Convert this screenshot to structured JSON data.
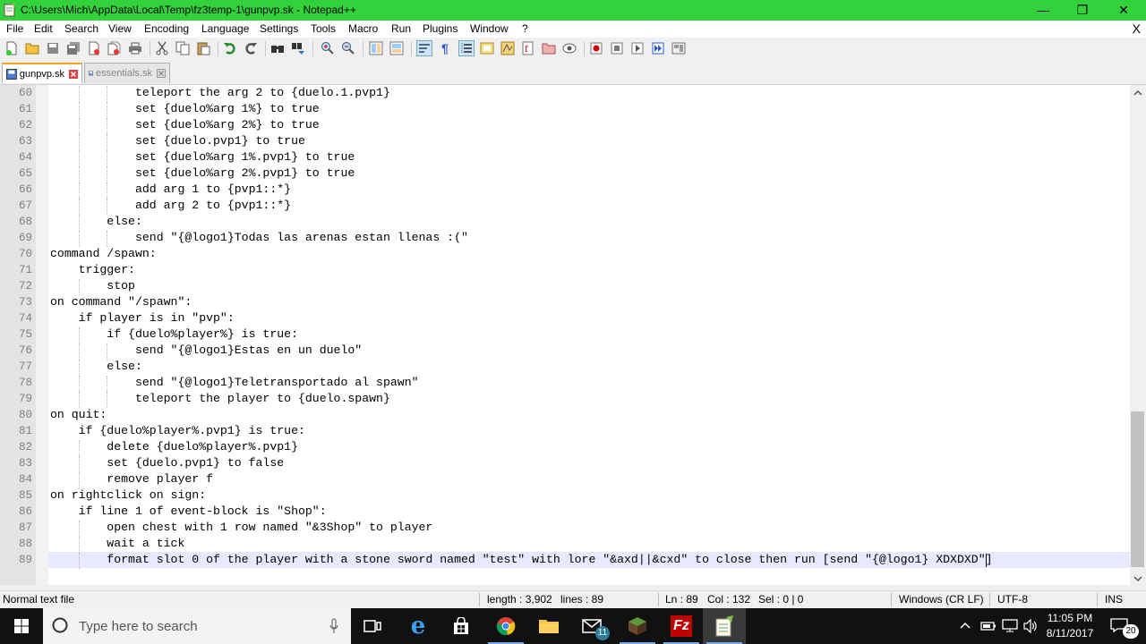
{
  "window": {
    "title": "C:\\Users\\Mich\\AppData\\Local\\Temp\\fz3temp-1\\gunpvp.sk - Notepad++",
    "app_icon": "notepad-plus-plus-icon",
    "minimize_glyph": "—",
    "maximize_glyph": "❐",
    "close_glyph": "✕"
  },
  "menu": {
    "items": [
      "File",
      "Edit",
      "Search",
      "View",
      "Encoding",
      "Language",
      "Settings",
      "Tools",
      "Macro",
      "Run",
      "Plugins",
      "Window",
      "?"
    ],
    "close_doc_glyph": "X"
  },
  "toolbar": {
    "icons": [
      "new-file-icon",
      "open-file-icon",
      "save-icon",
      "save-all-icon",
      "close-icon",
      "close-all-icon",
      "print-icon",
      "cut-icon",
      "copy-icon",
      "paste-icon",
      "undo-icon",
      "redo-icon",
      "find-icon",
      "replace-icon",
      "zoom-in-icon",
      "zoom-out-icon",
      "sync-vertical-icon",
      "sync-horizontal-icon",
      "word-wrap-icon",
      "show-all-chars-icon",
      "indent-guide-icon",
      "user-define-lang-icon",
      "doc-map-icon",
      "function-list-icon",
      "folder-workspace-icon",
      "monitoring-icon",
      "record-macro-icon",
      "stop-record-icon",
      "play-macro-icon",
      "run-macro-multiple-icon",
      "save-macro-icon"
    ]
  },
  "tabs": [
    {
      "label": "gunpvp.sk",
      "active": true
    },
    {
      "label": "essentials.sk",
      "active": false
    }
  ],
  "editor": {
    "lines": [
      {
        "n": "60",
        "text": "            teleport the arg 2 to {duelo.1.pvp1}"
      },
      {
        "n": "61",
        "text": "            set {duelo%arg 1%} to true"
      },
      {
        "n": "62",
        "text": "            set {duelo%arg 2%} to true"
      },
      {
        "n": "63",
        "text": "            set {duelo.pvp1} to true"
      },
      {
        "n": "64",
        "text": "            set {duelo%arg 1%.pvp1} to true"
      },
      {
        "n": "65",
        "text": "            set {duelo%arg 2%.pvp1} to true"
      },
      {
        "n": "66",
        "text": "            add arg 1 to {pvp1::*}"
      },
      {
        "n": "67",
        "text": "            add arg 2 to {pvp1::*}"
      },
      {
        "n": "68",
        "text": "        else:"
      },
      {
        "n": "69",
        "text": "            send \"{@logo1}Todas las arenas estan llenas :(\""
      },
      {
        "n": "70",
        "text": "command /spawn:"
      },
      {
        "n": "71",
        "text": "    trigger:"
      },
      {
        "n": "72",
        "text": "        stop"
      },
      {
        "n": "73",
        "text": "on command \"/spawn\":"
      },
      {
        "n": "74",
        "text": "    if player is in \"pvp\":"
      },
      {
        "n": "75",
        "text": "        if {duelo%player%} is true:"
      },
      {
        "n": "76",
        "text": "            send \"{@logo1}Estas en un duelo\""
      },
      {
        "n": "77",
        "text": "        else:"
      },
      {
        "n": "78",
        "text": "            send \"{@logo1}Teletransportado al spawn\""
      },
      {
        "n": "79",
        "text": "            teleport the player to {duelo.spawn}"
      },
      {
        "n": "80",
        "text": "on quit:"
      },
      {
        "n": "81",
        "text": "    if {duelo%player%.pvp1} is true:"
      },
      {
        "n": "82",
        "text": "        delete {duelo%player%.pvp1}"
      },
      {
        "n": "83",
        "text": "        set {duelo.pvp1} to false"
      },
      {
        "n": "84",
        "text": "        remove player f"
      },
      {
        "n": "85",
        "text": "on rightclick on sign:"
      },
      {
        "n": "86",
        "text": "    if line 1 of event-block is \"Shop\":"
      },
      {
        "n": "87",
        "text": "        open chest with 1 row named \"&3Shop\" to player"
      },
      {
        "n": "88",
        "text": "        wait a tick"
      },
      {
        "n": "89",
        "text": "        format slot 0 of the player with a stone sword named \"test\" with lore \"&axd||&cxd\" to close then run [send \"{@logo1} XDXDXD\"]"
      }
    ]
  },
  "status": {
    "file_type": "Normal text file",
    "length": "length : 3,902",
    "lines": "lines : 89",
    "ln": "Ln : 89",
    "col": "Col : 132",
    "sel": "Sel : 0 | 0",
    "eol": "Windows (CR LF)",
    "encoding": "UTF-8",
    "mode": "INS"
  },
  "taskbar": {
    "search_placeholder": "Type here to search",
    "apps": [
      "task-view-icon",
      "edge-icon",
      "store-icon",
      "chrome-icon",
      "file-explorer-icon",
      "mail-icon",
      "minecraft-icon",
      "filezilla-icon",
      "notepad-plus-plus-icon"
    ],
    "mail_badge": "11",
    "time": "11:05 PM",
    "date": "8/11/2017",
    "notification_count": "20"
  },
  "colors": {
    "title_bar": "#33d13c",
    "current_line": "#e8e8ff",
    "gutter": "#e4e4e4",
    "tab_accent": "#f5a623",
    "taskbar": "#111111"
  }
}
